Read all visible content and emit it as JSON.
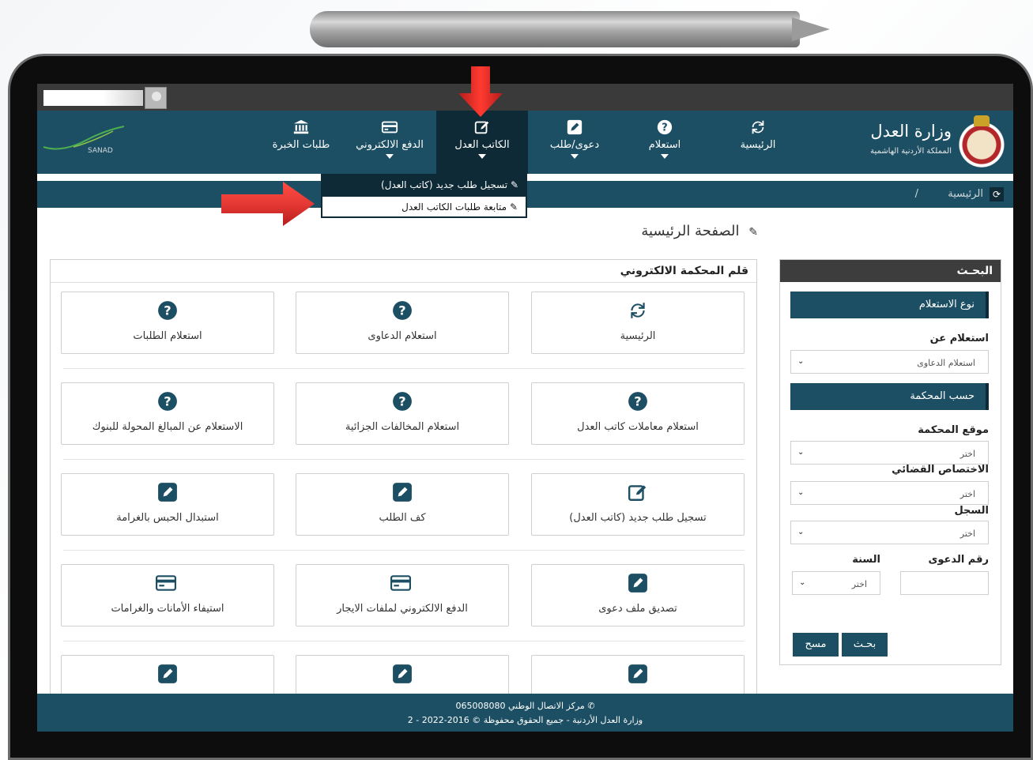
{
  "brand": {
    "title": "وزارة العدل",
    "subtitle": "المملكة الأردنية الهاشمية",
    "sanad_label": "SANAD"
  },
  "nav": {
    "items": [
      {
        "label": "الرئيسية",
        "icon": "refresh-icon"
      },
      {
        "label": "استعلام",
        "icon": "question-icon"
      },
      {
        "label": "دعوى/طلب",
        "icon": "edit-icon"
      },
      {
        "label": "الكاتب العدل",
        "icon": "pen-square-icon"
      },
      {
        "label": "الدفع الالكتروني",
        "icon": "credit-card-icon"
      },
      {
        "label": "طلبات الخبرة",
        "icon": "bank-icon"
      }
    ],
    "dropdown": [
      "تسجيل طلب جديد (كاتب العدل)",
      "متابعة طلبات الكاتب العدل"
    ]
  },
  "breadcrumb": {
    "home": "الرئيسية",
    "separator": "/"
  },
  "page_title": "الصفحة الرئيسية",
  "search": {
    "heading": "البحـث",
    "section_type": "نوع الاستعلام",
    "query_about_label": "استعلام عن",
    "query_about_value": "استعلام الدعاوى",
    "section_court": "حسب المحكمة",
    "court_location_label": "موقع المحكمة",
    "court_location_value": "اختر",
    "jurisdiction_label": "الاختصاص القضائي",
    "jurisdiction_value": "اختر",
    "register_label": "السجل",
    "register_value": "اختر",
    "case_number_label": "رقم الدعوى",
    "case_number_value": "",
    "year_label": "السنة",
    "year_value": "اختر",
    "search_button": "بحـث",
    "clear_button": "مسح"
  },
  "main": {
    "heading": "قلم المحكمة الالكتروني",
    "tiles": [
      {
        "label": "الرئيسية",
        "icon": "refresh-icon"
      },
      {
        "label": "استعلام الدعاوى",
        "icon": "question-icon"
      },
      {
        "label": "استعلام الطلبات",
        "icon": "question-icon"
      },
      {
        "label": "استعلام معاملات كاتب العدل",
        "icon": "question-icon"
      },
      {
        "label": "استعلام المخالفات الجزائية",
        "icon": "question-icon"
      },
      {
        "label": "الاستعلام عن المبالغ المحولة للبنوك",
        "icon": "question-icon"
      },
      {
        "label": "تسجيل طلب جديد (كاتب العدل)",
        "icon": "pen-square-icon"
      },
      {
        "label": "كف الطلب",
        "icon": "edit-icon"
      },
      {
        "label": "استبدال الحبس بالغرامة",
        "icon": "edit-icon"
      },
      {
        "label": "تصديق ملف دعوى",
        "icon": "edit-icon"
      },
      {
        "label": "الدفع الالكتروني لملفات الايجار",
        "icon": "credit-card-icon"
      },
      {
        "label": "استيفاء الأمانات والغرامات",
        "icon": "credit-card-icon"
      },
      {
        "label": "",
        "icon": "edit-icon"
      },
      {
        "label": "",
        "icon": "edit-icon"
      },
      {
        "label": "",
        "icon": "edit-icon"
      }
    ]
  },
  "footer": {
    "line1": "مركز الاتصال الوطني 065008080",
    "line2": "وزارة العدل الأردنية - جميع الحقوق محفوظة © 2016-2022 - 2"
  },
  "colors": {
    "primary": "#1c4f63",
    "dark": "#0e2a36",
    "arrow": "#e0302b"
  }
}
